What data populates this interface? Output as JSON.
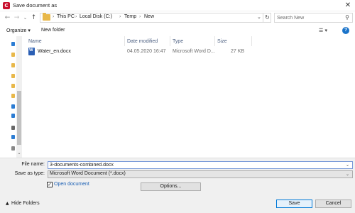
{
  "window": {
    "title": "Save document as",
    "app_icon_letter": "C",
    "close_glyph": "✕"
  },
  "navigation": {
    "back_glyph": "←",
    "forward_glyph": "→",
    "recent_glyph": "⌄",
    "up_glyph": "↑",
    "breadcrumb": [
      "This PC",
      "Local Disk (C:)",
      "Temp",
      "New"
    ],
    "separator_glyph": "›",
    "leading_separator_glyph": "›",
    "dropdown_glyph": "⌄",
    "refresh_glyph": "↻"
  },
  "search": {
    "placeholder": "Search New",
    "icon": "search-icon",
    "icon_glyph": "⚲"
  },
  "toolbar": {
    "organize_label": "Organize ▾",
    "new_folder_label": "New folder",
    "views_glyph": "☰ ▾",
    "help_glyph": "?"
  },
  "columns": [
    "Name",
    "Date modified",
    "Type",
    "Size"
  ],
  "files": [
    {
      "name": "Water_en.docx",
      "date_modified": "04.05.2020 16:47",
      "type": "Microsoft Word D...",
      "size": "27 KB",
      "icon": "word-document-icon"
    }
  ],
  "nav_pane": {
    "icon_colors": [
      "#2b7cd3",
      "#e8b84a",
      "#e8b84a",
      "#e8b84a",
      "#e8b84a",
      "#e8b84a",
      "#2b7cd3",
      "#2b7cd3",
      "#666666",
      "#2b7cd3",
      "#888888"
    ],
    "scroll_down_glyph": "⌄"
  },
  "form": {
    "file_name_label": "File name:",
    "file_name_value": "3-documents-combined.docx",
    "save_as_type_label": "Save as type:",
    "save_as_type_value": "Microsoft Word Document (*.docx)",
    "dropdown_glyph": "⌄",
    "open_document_label": "Open document",
    "open_document_checked": true,
    "check_glyph": "✓",
    "options_label": "Options..."
  },
  "footer": {
    "hide_folders_label": "Hide Folders",
    "hide_folders_glyph": "▲",
    "save_label": "Save",
    "cancel_label": "Cancel"
  },
  "colors": {
    "accent": "#0078d7",
    "link": "#1a5fb4",
    "header_text": "#4d6082",
    "app_icon": "#c8102e"
  }
}
